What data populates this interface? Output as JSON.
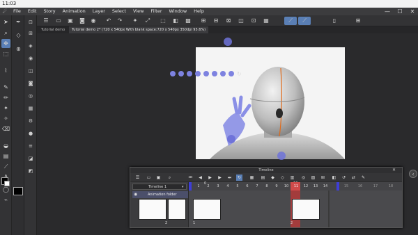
{
  "status_bar": {
    "time": "11:03"
  },
  "menu": {
    "items": [
      "File",
      "Edit",
      "Story",
      "Animation",
      "Layer",
      "Select",
      "View",
      "Filter",
      "Window",
      "Help"
    ],
    "minimize": "—",
    "maximize": "☐",
    "close": "✕"
  },
  "tabs": [
    {
      "label": "Tutorial demo",
      "active": false
    },
    {
      "label": "Tutorial demo 2* (720 x 540px With blank space:720 x 540px 350dpi 95.6%)",
      "active": true
    }
  ],
  "timeline": {
    "panel_title": "Timeline",
    "name": "Timeline 1",
    "folder_label": "Animation folder",
    "frame_numbers": [
      "1",
      "2",
      "3",
      "4",
      "5",
      "6",
      "7",
      "8",
      "9",
      "10",
      "11",
      "12",
      "13",
      "14",
      "15",
      "16",
      "17",
      "18"
    ],
    "ruler_marker_left": "0",
    "ruler_marker_right": "10",
    "cell_labels": [
      "2",
      "1",
      "2"
    ],
    "current_frame": "11",
    "accent_color": "#d04a4a",
    "marker_color": "#3e3ed6"
  },
  "colors": {
    "accent_selected": "#5a7fb5",
    "paper": "#f4f4f4"
  },
  "icons": {
    "toolbar_right": [
      "pen-pressure-icon",
      "pen-pressure-icon",
      "phone-icon",
      "grid-icon"
    ]
  }
}
